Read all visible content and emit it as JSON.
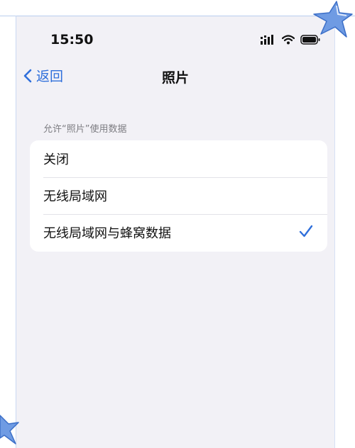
{
  "status_bar": {
    "time": "15:50"
  },
  "nav": {
    "back_label": "返回",
    "title": "照片"
  },
  "section": {
    "header": "允许“照片”使用数据"
  },
  "options": [
    {
      "label": "关闭",
      "selected": false
    },
    {
      "label": "无线局域网",
      "selected": false
    },
    {
      "label": "无线局域网与蜂窝数据",
      "selected": true
    }
  ],
  "colors": {
    "accent": "#2f6fdb",
    "background": "#f2f1f6",
    "card": "#ffffff",
    "star": "#6f9be3"
  }
}
